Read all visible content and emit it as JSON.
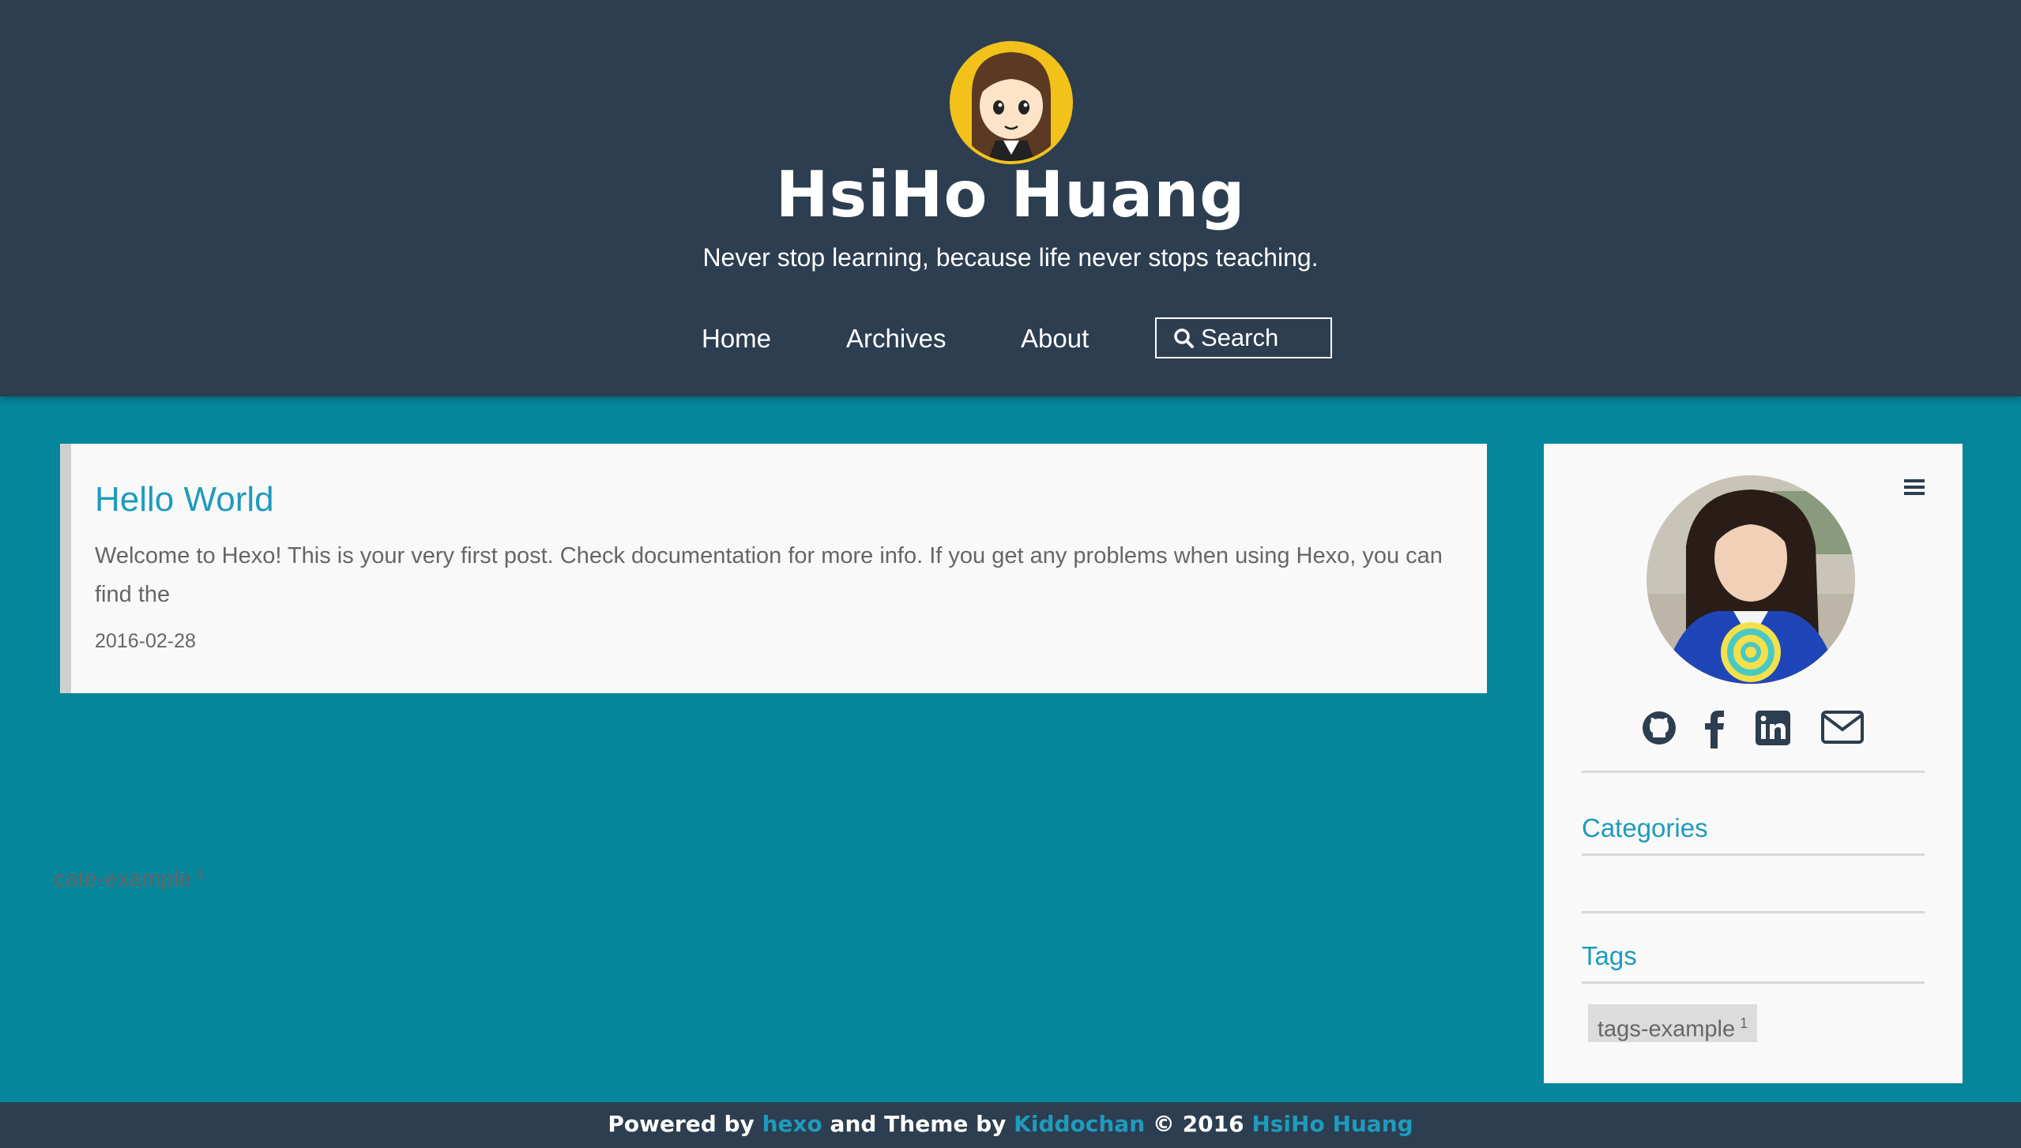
{
  "header": {
    "title": "HsiHo Huang",
    "subtitle": "Never stop learning, because life never stops teaching.",
    "nav": {
      "home": "Home",
      "archives": "Archives",
      "about": "About",
      "search": "Search"
    }
  },
  "posts": [
    {
      "title": "Hello World",
      "excerpt": "Welcome to Hexo! This is your very first post. Check documentation for more info. If you get any problems when using Hexo, you can find the",
      "date": "2016-02-28"
    }
  ],
  "sidebar": {
    "social_icons": [
      "github-icon",
      "facebook-icon",
      "linkedin-icon",
      "mail-icon"
    ],
    "categories_title": "Categories",
    "categories": [
      {
        "name": "cate-example",
        "count": "1"
      }
    ],
    "tags_title": "Tags",
    "tags": [
      {
        "name": "tags-example",
        "count": "1"
      }
    ]
  },
  "footer": {
    "powered_by": "Powered by",
    "hexo": "hexo",
    "theme_by": "and Theme by",
    "kiddochan": "Kiddochan",
    "copyright": "© 2016",
    "author": "HsiHo Huang"
  },
  "colors": {
    "header_bg": "#2c3e50",
    "page_bg": "#06869b",
    "accent": "#1e9bbd",
    "card_bg": "#f9f9f9"
  }
}
